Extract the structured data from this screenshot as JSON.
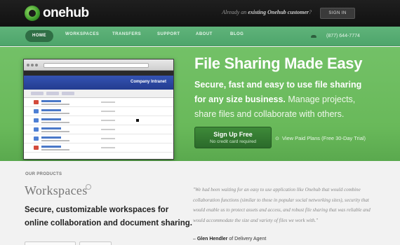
{
  "header": {
    "logo_text": "onehub",
    "customer_prompt_prefix": "Already an ",
    "customer_prompt_bold": "existing Onehub customer",
    "customer_prompt_suffix": "?",
    "signin_label": "SIGN IN"
  },
  "nav": {
    "items": [
      "HOME",
      "WORKSPACES",
      "TRANSFERS",
      "SUPPORT",
      "ABOUT",
      "BLOG"
    ],
    "active": "HOME",
    "phone": "(877) 644-7774"
  },
  "hero": {
    "title": "File Sharing Made Easy",
    "desc_bold": "Secure, fast and easy to use file sharing for any size business.",
    "desc_rest": " Manage projects, share files and collaborate with others.",
    "signup_label": "Sign Up Free",
    "signup_sub": "No credit card required",
    "paid_link": "View Paid Plans (Free 30-Day Trial)",
    "screenshot": {
      "intranet_title": "Company Intranet"
    }
  },
  "products": {
    "section_label": "OUR PRODUCTS",
    "workspaces_title": "Workspaces",
    "workspaces_desc": "Secure, customizable workspaces for online collaboration and document sharing."
  },
  "testimonial": {
    "quote": "\"We had been waiting for an easy to use application like Onehub that would combine collaboration functions (similar to those in popular social networking sites), security that would enable us to protect assets and access, and robust file sharing that was reliable and would accommodate the size and variety of files we work with.\"",
    "dash": "– ",
    "author": "Glen Hendler",
    "author_suffix": " of Delivery Agent"
  },
  "colors": {
    "topbar": "#151515",
    "nav_green": "#58ad74",
    "hero_green": "#6cbb5e",
    "signup_green": "#347c31"
  }
}
